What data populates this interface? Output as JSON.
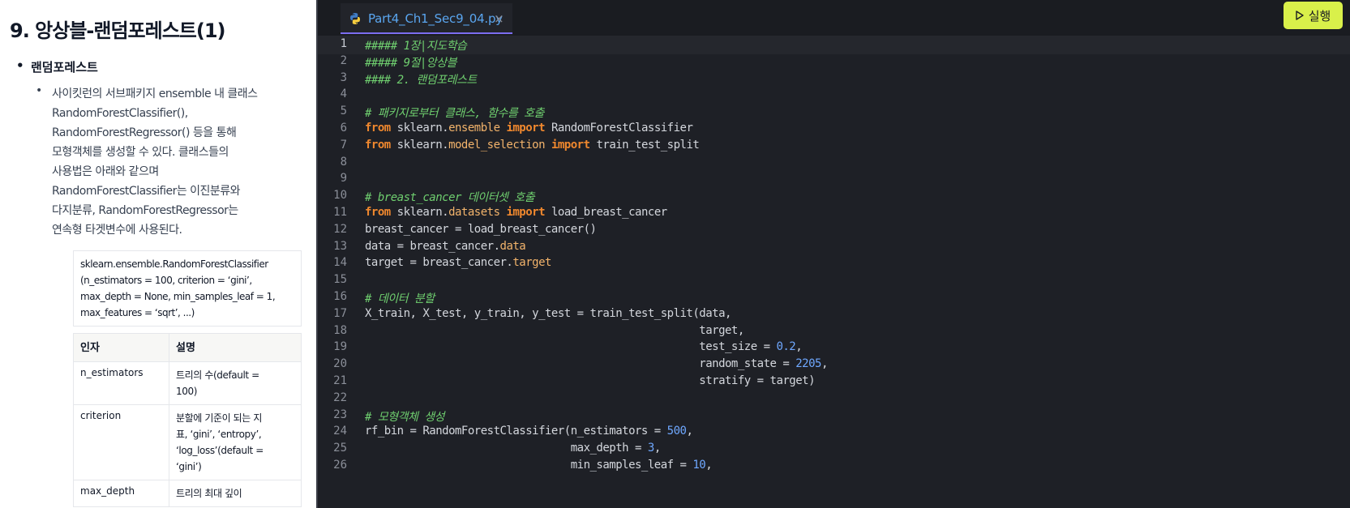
{
  "lesson": {
    "title": "9. 앙상블-랜덤포레스트(1)",
    "bullet1": "랜덤포레스트",
    "bullet2_lines": [
      "사이킷런의 서브패키지 ensemble 내 클래스",
      "RandomForestClassifier(),",
      "RandomForestRegressor() 등을 통해",
      "모형객체를 생성할 수 있다. 클래스들의",
      "사용법은 아래와 같으며",
      "RandomForestClassifier는 이진분류와",
      "다지분류, RandomForestRegressor는",
      "연속형 타겟변수에 사용된다."
    ],
    "signature_lines": [
      "sklearn.ensemble.RandomForestClassifier",
      "(n_estimators = 100, criterion = ‘gini’,",
      "max_depth = None, min_samples_leaf = 1,",
      "max_features = ‘sqrt’, ...)"
    ],
    "table": {
      "headers": [
        "인자",
        "설명"
      ],
      "rows": [
        {
          "param": "n_estimators",
          "desc_lines": [
            "트리의 수(default =",
            "100)"
          ]
        },
        {
          "param": "criterion",
          "desc_lines": [
            "분할에 기준이 되는 지",
            "표, ‘gini’, ‘entropy’,",
            "‘log_loss’(default =",
            "‘gini’)"
          ]
        },
        {
          "param": "max_depth",
          "desc_lines": [
            "트리의 최대 깊이"
          ]
        }
      ]
    }
  },
  "editor": {
    "tab_filename": "Part4_Ch1_Sec9_04.py",
    "close_glyph": "×",
    "run_label": "실행",
    "run_icon": "play-outline-icon",
    "colors": {
      "run_button": "#d9f04a",
      "tab_text": "#5aa6f0",
      "comment": "#6fcf6f",
      "keyword": "#f0882e",
      "attribute": "#f2b36b",
      "number": "#6fa8ff"
    },
    "active_line": 1,
    "lines": [
      {
        "n": "1",
        "tokens": [
          {
            "t": "comment",
            "v": "##### 1장|지도학습"
          }
        ]
      },
      {
        "n": "2",
        "tokens": [
          {
            "t": "comment",
            "v": "##### 9절|앙상블"
          }
        ]
      },
      {
        "n": "3",
        "tokens": [
          {
            "t": "comment",
            "v": "#### 2. 랜덤포레스트"
          }
        ]
      },
      {
        "n": "4",
        "tokens": []
      },
      {
        "n": "5",
        "tokens": [
          {
            "t": "comment",
            "v": "# 패키지로부터 클래스, 함수를 호출"
          }
        ]
      },
      {
        "n": "6",
        "tokens": [
          {
            "t": "keyword",
            "v": "from"
          },
          {
            "t": "plain",
            "v": " sklearn."
          },
          {
            "t": "attr",
            "v": "ensemble"
          },
          {
            "t": "plain",
            "v": " "
          },
          {
            "t": "keyword",
            "v": "import"
          },
          {
            "t": "plain",
            "v": " RandomForestClassifier"
          }
        ]
      },
      {
        "n": "7",
        "tokens": [
          {
            "t": "keyword",
            "v": "from"
          },
          {
            "t": "plain",
            "v": " sklearn."
          },
          {
            "t": "attr",
            "v": "model_selection"
          },
          {
            "t": "plain",
            "v": " "
          },
          {
            "t": "keyword",
            "v": "import"
          },
          {
            "t": "plain",
            "v": " train_test_split"
          }
        ]
      },
      {
        "n": "8",
        "tokens": []
      },
      {
        "n": "9",
        "tokens": []
      },
      {
        "n": "10",
        "tokens": [
          {
            "t": "comment",
            "v": "# breast_cancer 데이터셋 호출"
          }
        ]
      },
      {
        "n": "11",
        "tokens": [
          {
            "t": "keyword",
            "v": "from"
          },
          {
            "t": "plain",
            "v": " sklearn."
          },
          {
            "t": "attr",
            "v": "datasets"
          },
          {
            "t": "plain",
            "v": " "
          },
          {
            "t": "keyword",
            "v": "import"
          },
          {
            "t": "plain",
            "v": " load_breast_cancer"
          }
        ]
      },
      {
        "n": "12",
        "tokens": [
          {
            "t": "plain",
            "v": "breast_cancer = load_breast_cancer()"
          }
        ]
      },
      {
        "n": "13",
        "tokens": [
          {
            "t": "plain",
            "v": "data = breast_cancer."
          },
          {
            "t": "attr",
            "v": "data"
          }
        ]
      },
      {
        "n": "14",
        "tokens": [
          {
            "t": "plain",
            "v": "target = breast_cancer."
          },
          {
            "t": "attr",
            "v": "target"
          }
        ]
      },
      {
        "n": "15",
        "tokens": []
      },
      {
        "n": "16",
        "tokens": [
          {
            "t": "comment",
            "v": "# 데이터 분할"
          }
        ]
      },
      {
        "n": "17",
        "tokens": [
          {
            "t": "plain",
            "v": "X_train, X_test, y_train, y_test = train_test_split(data,"
          }
        ]
      },
      {
        "n": "18",
        "tokens": [
          {
            "t": "plain",
            "v": "                                                    target,"
          }
        ]
      },
      {
        "n": "19",
        "tokens": [
          {
            "t": "plain",
            "v": "                                                    test_size = "
          },
          {
            "t": "number",
            "v": "0.2"
          },
          {
            "t": "plain",
            "v": ","
          }
        ]
      },
      {
        "n": "20",
        "tokens": [
          {
            "t": "plain",
            "v": "                                                    random_state = "
          },
          {
            "t": "number",
            "v": "2205"
          },
          {
            "t": "plain",
            "v": ","
          }
        ]
      },
      {
        "n": "21",
        "tokens": [
          {
            "t": "plain",
            "v": "                                                    stratify = target)"
          }
        ]
      },
      {
        "n": "22",
        "tokens": []
      },
      {
        "n": "23",
        "tokens": [
          {
            "t": "comment",
            "v": "# 모형객체 생성"
          }
        ]
      },
      {
        "n": "24",
        "tokens": [
          {
            "t": "plain",
            "v": "rf_bin = RandomForestClassifier(n_estimators = "
          },
          {
            "t": "number",
            "v": "500"
          },
          {
            "t": "plain",
            "v": ","
          }
        ]
      },
      {
        "n": "25",
        "tokens": [
          {
            "t": "plain",
            "v": "                                max_depth = "
          },
          {
            "t": "number",
            "v": "3"
          },
          {
            "t": "plain",
            "v": ","
          }
        ]
      },
      {
        "n": "26",
        "tokens": [
          {
            "t": "plain",
            "v": "                                min_samples_leaf = "
          },
          {
            "t": "number",
            "v": "10"
          },
          {
            "t": "plain",
            "v": ","
          }
        ]
      }
    ]
  }
}
